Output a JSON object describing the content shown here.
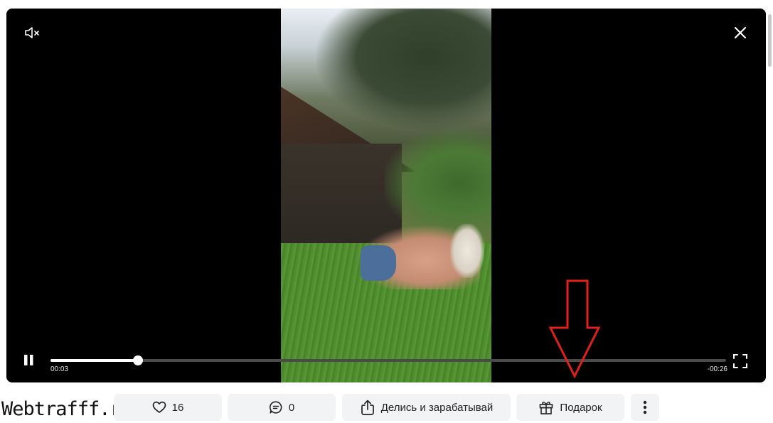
{
  "player": {
    "current_time": "00:03",
    "remaining_time": "-00:26",
    "progress": 0.129
  },
  "actions": {
    "likes_count": "16",
    "comments_count": "0",
    "share_label": "Делись и зарабатывай",
    "gift_label": "Подарок"
  },
  "watermark": "Webtrafff.ru",
  "colors": {
    "annotation_arrow": "#e0201c",
    "player_bg": "#000000",
    "button_bg": "#f2f3f5"
  }
}
